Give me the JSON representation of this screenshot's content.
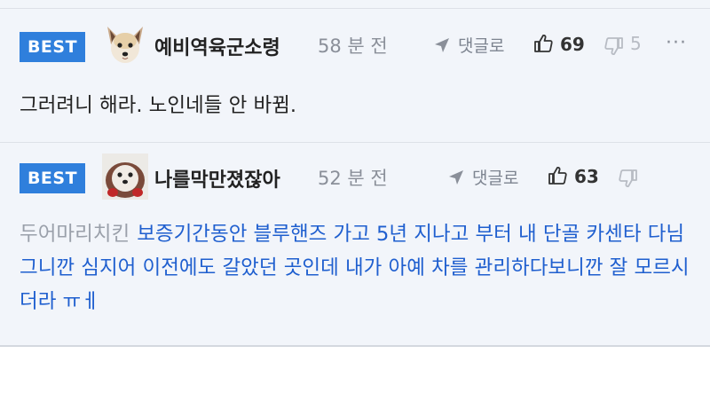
{
  "colors": {
    "badge": "#2f7fdc",
    "link_text": "#1f5fcf",
    "muted": "#8a8f99",
    "panel_bg": "#f2f5fa"
  },
  "comments": [
    {
      "badge": "BEST",
      "avatar_icon": "dog-avatar-icon",
      "nickname": "예비역육군소령",
      "time": "58 분 전",
      "reply_label": "댓글로",
      "likes": "69",
      "dislikes": "5",
      "more": "···",
      "text": "그러려니 해라. 노인네들 안 바뀜."
    },
    {
      "badge": "BEST",
      "avatar_icon": "pet-avatar-icon",
      "nickname": "나를막만졌잖아",
      "time": "52 분 전",
      "reply_label": "댓글로",
      "likes": "63",
      "dislikes": "",
      "mention": "두어마리치킨",
      "text": "보증기간동안 블루핸즈 가고 5년 지나고 부터 내 단골 카센타 다님 그니깐 심지어 이전에도 갈았던 곳인데 내가 아예 차를 관리하다보니깐 잘 모르시더라 ㅠㅔ"
    }
  ]
}
